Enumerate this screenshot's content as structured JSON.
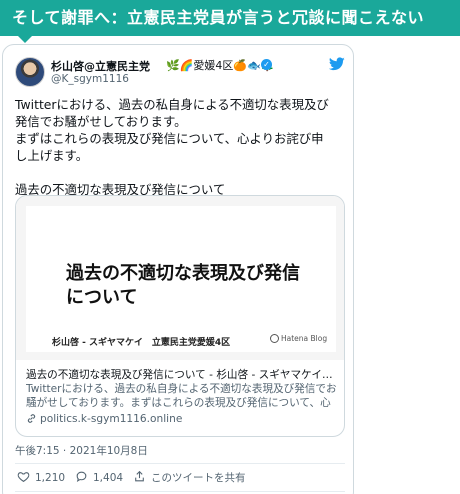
{
  "banner": {
    "title": "そして謝罪へ：立憲民主党員が言うと冗談に聞こえない"
  },
  "tweet": {
    "display_name": "杉山啓@立憲民主党",
    "emojis": "🌿🌈愛媛4区🍊🐟🌲",
    "handle": "@K_sgym1116",
    "text": "Twitterにおける、過去の私自身による不適切な表現及び\n発信でお騒がせしております。\nまずはこれらの表現及び発信について、心よりお詫び申\nし上げます。\n\n過去の不適切な表現及び発信について",
    "timestamp": "午後7:15 · 2021年10月8日",
    "likes": "1,210",
    "retweets": "1,404",
    "share_label": "このツイートを共有"
  },
  "card": {
    "image_title": "過去の不適切な表現及び発信について",
    "author_line": "杉山啓 - スギヤマケイ　立憲民主党愛媛4区",
    "badge_label": "Hatena Blog",
    "title": "過去の不適切な表現及び発信について - 杉山啓 - スギヤマケイ　立憲民…",
    "description": "Twitterにおける、過去の私自身による不適切な表現及び発信でお騒がせしております。まずはこれらの表現及び発信について、心よりお詫び…",
    "domain": "politics.k-sgym1116.online"
  },
  "colors": {
    "banner": "#1aa89a",
    "twitter_blue": "#1d9bf0",
    "muted": "#536471"
  },
  "icons": [
    "verified-icon",
    "twitter-bird-icon",
    "link-icon",
    "heart-icon",
    "comment-icon",
    "share-icon"
  ]
}
